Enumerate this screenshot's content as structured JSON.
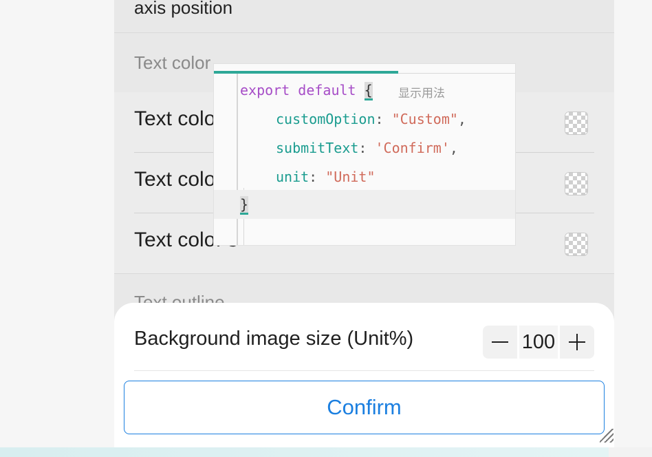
{
  "sections": {
    "axis_position_title": "axis position",
    "text_color_title": "Text color",
    "text_outline_title": "Text outline"
  },
  "rows": [
    {
      "label": "Text colo"
    },
    {
      "label": "Text colo"
    },
    {
      "label": "Text colo. 3"
    }
  ],
  "code_tooltip": {
    "hint": "显示用法",
    "keyword": "export default",
    "open_brace": "{",
    "close_brace": "}",
    "lines": [
      {
        "key": "customOption",
        "value": "\"Custom\"",
        "trail": ","
      },
      {
        "key": "submitText",
        "value": "'Confirm'",
        "trail": ","
      },
      {
        "key": "unit",
        "value": "\"Unit\"",
        "trail": ""
      }
    ]
  },
  "sheet": {
    "title": "Background image size (Unit%)",
    "stepper_value": "100",
    "confirm_label": "Confirm"
  },
  "colors": {
    "accent_blue": "#1b7fe0",
    "code_teal": "#2ea897"
  }
}
